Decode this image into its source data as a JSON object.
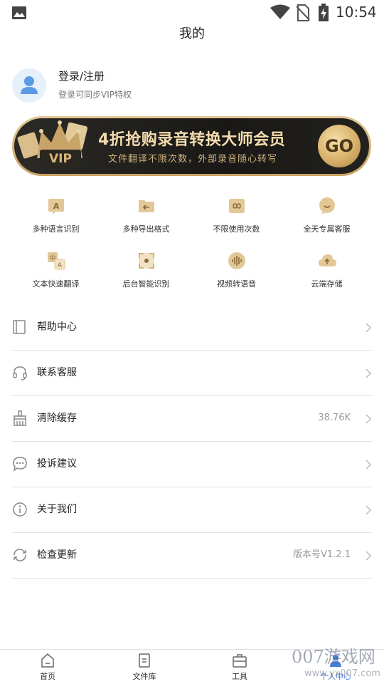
{
  "status_bar": {
    "time": "10:54"
  },
  "header": {
    "title": "我的"
  },
  "profile": {
    "login_label": "登录/注册",
    "login_subtitle": "登录可同步VIP特权"
  },
  "vip_banner": {
    "badge": "VIP",
    "title": "4折抢购录音转换大师会员",
    "subtitle": "文件翻译不限次数，外部录音随心转写",
    "go_label": "GO"
  },
  "features": [
    {
      "label": "多种语言识别",
      "icon": "translate-a-icon"
    },
    {
      "label": "多种导出格式",
      "icon": "export-folder-icon"
    },
    {
      "label": "不限使用次数",
      "icon": "infinity-icon"
    },
    {
      "label": "全天专属客服",
      "icon": "chat-smile-icon"
    },
    {
      "label": "文本快速翻译",
      "icon": "zh-a-translate-icon"
    },
    {
      "label": "后台智能识别",
      "icon": "scan-frame-icon"
    },
    {
      "label": "视频转语音",
      "icon": "audio-wave-icon"
    },
    {
      "label": "云端存储",
      "icon": "cloud-upload-icon"
    }
  ],
  "menu": [
    {
      "label": "帮助中心",
      "value": "",
      "icon": "book-icon"
    },
    {
      "label": "联系客服",
      "value": "",
      "icon": "headset-icon"
    },
    {
      "label": "清除缓存",
      "value": "38.76K",
      "icon": "broom-icon"
    },
    {
      "label": "投诉建议",
      "value": "",
      "icon": "comment-icon"
    },
    {
      "label": "关于我们",
      "value": "",
      "icon": "info-icon"
    },
    {
      "label": "检查更新",
      "value": "版本号V1.2.1",
      "icon": "refresh-icon"
    }
  ],
  "bottom_nav": [
    {
      "label": "首页",
      "icon": "home-icon"
    },
    {
      "label": "文件库",
      "icon": "file-icon"
    },
    {
      "label": "工具",
      "icon": "toolbox-icon"
    },
    {
      "label": "个人中心",
      "icon": "person-icon"
    }
  ],
  "watermark": {
    "text": "007游戏网",
    "url": "www.yx007.com"
  },
  "colors": {
    "gold": "#d8b06a",
    "banner_dark": "#1c1b18",
    "divider": "#e2e2e2",
    "active_nav": "#4a7fd6"
  }
}
